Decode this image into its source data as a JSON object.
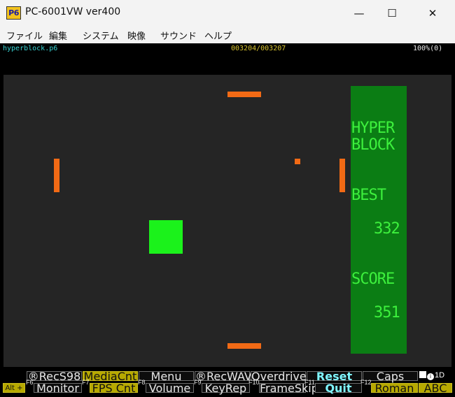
{
  "window": {
    "title": "PC-6001VW ver400",
    "icon_text": "P6",
    "minimize_glyph": "—",
    "maximize_glyph": "☐",
    "close_glyph": "✕"
  },
  "menu": [
    "ファイル",
    "編集",
    "システム",
    "映像",
    "サウンド",
    "ヘルプ"
  ],
  "status": {
    "filename": "hyperblock.p6",
    "counter": "003204/003207",
    "speed": "100%(0)"
  },
  "game": {
    "title_line1": "HYPER",
    "title_line2": "BLOCK",
    "best_label": "BEST",
    "best_value": "332",
    "score_label": "SCORE",
    "score_value": "351",
    "colors": {
      "background": "#252525",
      "paddle": "#f26a15",
      "block": "#1bf21b",
      "panel": "#0b7d14",
      "panel_text": "#3df03d"
    }
  },
  "function_keys": {
    "top_row": [
      "®RecS98",
      "MediaCnt",
      "Menu",
      "®RecWAV",
      "Overdrive",
      "Reset",
      "Caps"
    ],
    "bottom_row": [
      "Monitor",
      "FPS Cnt",
      "Volume",
      "KeyRep",
      "FrameSkip",
      "Quit",
      "Roman",
      "ABC"
    ],
    "labels": [
      "F6",
      "F7",
      "F8",
      "F9",
      "F10",
      "F11",
      "F12"
    ],
    "alt_label": "Alt +",
    "indicator": "1D"
  }
}
